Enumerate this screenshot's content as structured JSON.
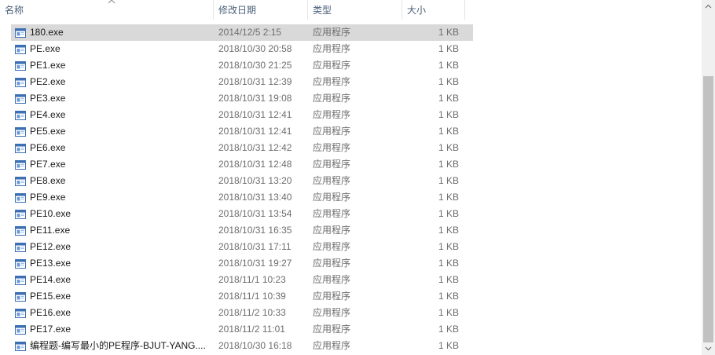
{
  "columns": {
    "name": "名称",
    "date": "修改日期",
    "type": "类型",
    "size": "大小"
  },
  "files": [
    {
      "name": "180.exe",
      "date": "2014/12/5 2:15",
      "type": "应用程序",
      "size": "1 KB",
      "selected": true
    },
    {
      "name": "PE.exe",
      "date": "2018/10/30 20:58",
      "type": "应用程序",
      "size": "1 KB"
    },
    {
      "name": "PE1.exe",
      "date": "2018/10/30 21:25",
      "type": "应用程序",
      "size": "1 KB"
    },
    {
      "name": "PE2.exe",
      "date": "2018/10/31 12:39",
      "type": "应用程序",
      "size": "1 KB"
    },
    {
      "name": "PE3.exe",
      "date": "2018/10/31 19:08",
      "type": "应用程序",
      "size": "1 KB"
    },
    {
      "name": "PE4.exe",
      "date": "2018/10/31 12:41",
      "type": "应用程序",
      "size": "1 KB"
    },
    {
      "name": "PE5.exe",
      "date": "2018/10/31 12:41",
      "type": "应用程序",
      "size": "1 KB"
    },
    {
      "name": "PE6.exe",
      "date": "2018/10/31 12:42",
      "type": "应用程序",
      "size": "1 KB"
    },
    {
      "name": "PE7.exe",
      "date": "2018/10/31 12:48",
      "type": "应用程序",
      "size": "1 KB"
    },
    {
      "name": "PE8.exe",
      "date": "2018/10/31 13:20",
      "type": "应用程序",
      "size": "1 KB"
    },
    {
      "name": "PE9.exe",
      "date": "2018/10/31 13:40",
      "type": "应用程序",
      "size": "1 KB"
    },
    {
      "name": "PE10.exe",
      "date": "2018/10/31 13:54",
      "type": "应用程序",
      "size": "1 KB"
    },
    {
      "name": "PE11.exe",
      "date": "2018/10/31 16:35",
      "type": "应用程序",
      "size": "1 KB"
    },
    {
      "name": "PE12.exe",
      "date": "2018/10/31 17:11",
      "type": "应用程序",
      "size": "1 KB"
    },
    {
      "name": "PE13.exe",
      "date": "2018/10/31 19:27",
      "type": "应用程序",
      "size": "1 KB"
    },
    {
      "name": "PE14.exe",
      "date": "2018/11/1 10:23",
      "type": "应用程序",
      "size": "1 KB"
    },
    {
      "name": "PE15.exe",
      "date": "2018/11/1 10:39",
      "type": "应用程序",
      "size": "1 KB"
    },
    {
      "name": "PE16.exe",
      "date": "2018/11/2 10:33",
      "type": "应用程序",
      "size": "1 KB"
    },
    {
      "name": "PE17.exe",
      "date": "2018/11/2 11:01",
      "type": "应用程序",
      "size": "1 KB"
    },
    {
      "name": "编程题-编写最小的PE程序-BJUT-YANG....",
      "date": "2018/10/30 16:18",
      "type": "应用程序",
      "size": "1 KB"
    }
  ],
  "icons": {
    "file": "exe-file-icon",
    "sort": "sort-ascending-icon"
  },
  "colors": {
    "selected_row": "#d9d9d9",
    "header_text": "#4c607a",
    "scroll_thumb": "#c1c1c1"
  }
}
